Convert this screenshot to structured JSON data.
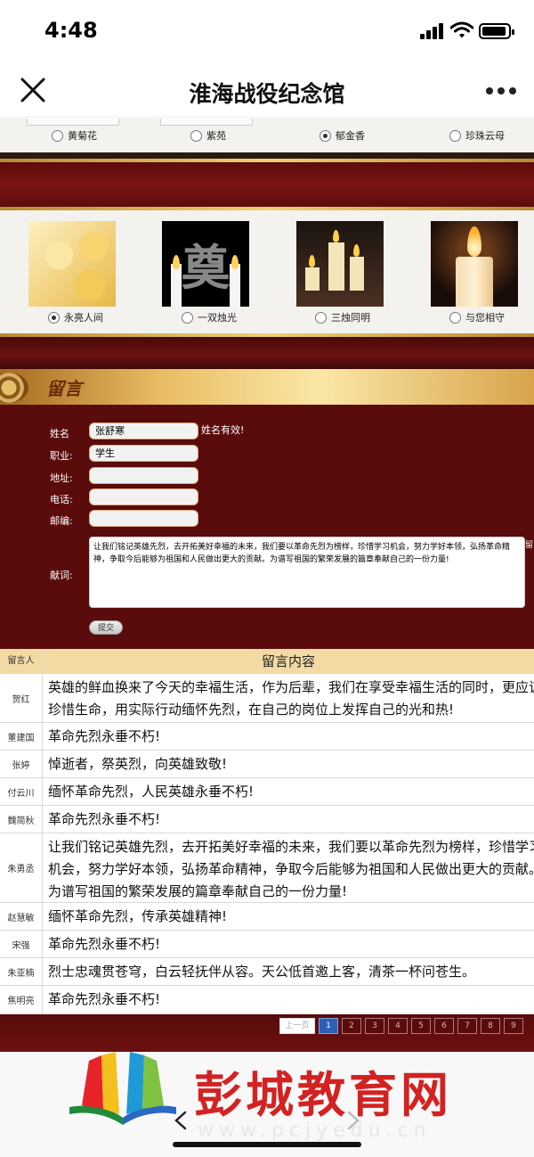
{
  "status": {
    "time": "4:48"
  },
  "nav": {
    "title": "淮海战役纪念馆"
  },
  "flowers": {
    "options": [
      {
        "label": "黄菊花",
        "selected": false
      },
      {
        "label": "紫苑",
        "selected": false
      },
      {
        "label": "郁金香",
        "selected": true
      },
      {
        "label": "珍珠云母",
        "selected": false
      }
    ]
  },
  "candles": {
    "pic2_char": "奠",
    "options": [
      {
        "label": "永亮人间",
        "selected": true
      },
      {
        "label": "一双烛光",
        "selected": false
      },
      {
        "label": "三烛同明",
        "selected": false
      },
      {
        "label": "与您相守",
        "selected": false
      }
    ]
  },
  "message_section": {
    "title": "留言"
  },
  "form": {
    "name_label": "姓名",
    "name_value": "张舒寒",
    "name_valid_note": "姓名有效!",
    "job_label": "职业:",
    "job_value": "学生",
    "address_label": "地址:",
    "address_value": "",
    "phone_label": "电话:",
    "phone_value": "",
    "postcode_label": "邮编:",
    "postcode_value": "",
    "dedication_label": "献词:",
    "dedication_value": "让我们铭记英雄先烈，去开拓美好幸福的未来，我们要以革命先烈为榜样，珍惜学习机会，努力学好本领，弘扬革命精神，争取今后能够为祖国和人民做出更大的贡献。为谱写祖国的繁荣发展的篇章奉献自己的一份力量!",
    "dedication_side": "留",
    "submit_label": "提交"
  },
  "table": {
    "col_name": "留言人",
    "col_content": "留言内容",
    "rows": [
      {
        "name": "贺红",
        "content": "英雄的鲜血换来了今天的幸福生活，作为后辈，我们在享受幸福生活的同时，更应该珍惜生命，用实际行动缅怀先烈，在自己的岗位上发挥自己的光和热!"
      },
      {
        "name": "董建国",
        "content": "革命先烈永垂不朽!"
      },
      {
        "name": "张婷",
        "content": "悼逝者，祭英烈，向英雄致敬!"
      },
      {
        "name": "付云川",
        "content": "缅怀革命先烈，人民英雄永垂不朽!"
      },
      {
        "name": "魏简秋",
        "content": "革命先烈永垂不朽!"
      },
      {
        "name": "朱勇丞",
        "content": "让我们铭记英雄先烈，去开拓美好幸福的未来，我们要以革命先烈为榜样，珍惜学习机会，努力学好本领，弘扬革命精神，争取今后能够为祖国和人民做出更大的贡献。为谱写祖国的繁荣发展的篇章奉献自己的一份力量!"
      },
      {
        "name": "赵慧敏",
        "content": "缅怀革命先烈，传承英雄精神!"
      },
      {
        "name": "宋强",
        "content": "革命先烈永垂不朽!"
      },
      {
        "name": "朱亚楠",
        "content": "烈士忠魂贯苍穹，白云轻抚伴从容。天公低首邀上客，清茶一杯问苍生。"
      },
      {
        "name": "焦明亮",
        "content": "革命先烈永垂不朽!"
      }
    ]
  },
  "pager": {
    "prev_label": "上一页",
    "pages": [
      "1",
      "2",
      "3",
      "4",
      "5",
      "6",
      "7",
      "8",
      "9"
    ],
    "current": "1"
  },
  "watermark": {
    "title": "彭城教育网",
    "url": "www.pcjyedu.cn"
  },
  "colors": {
    "maroon": "#5a0c0c",
    "gold": "#e9bd63",
    "page_active": "#2f5fb8",
    "watermark_red": "#d32222"
  }
}
